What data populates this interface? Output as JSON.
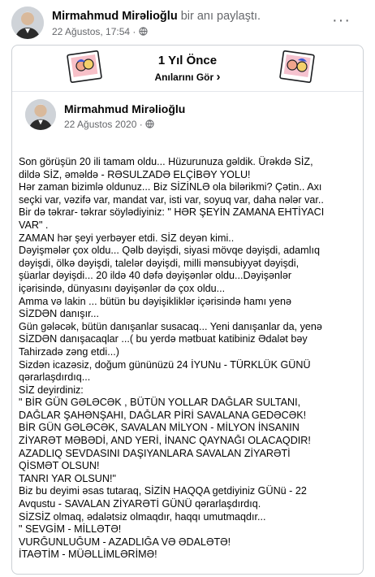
{
  "header": {
    "author": "Mirmahmud Mirəlioğlu",
    "action": "bir anı paylaştı.",
    "timestamp": "22 Ağustos, 17:54",
    "more_label": "···"
  },
  "memory": {
    "title": "1 Yıl Önce",
    "subtitle": "Anılarını Gör",
    "chevron": "›"
  },
  "original_post": {
    "author": "Mirmahmud Mirəlioğlu",
    "date": "22 Ağustos 2020",
    "lines": [
      "Son görüşün 20 ili tamam oldu... Hüzurunuza gəldik. Ürəkdə SİZ,",
      "dildə SİZ, əməldə - RƏSULZADƏ ELÇİBƏY YOLU!",
      "Hər zaman bizimlə oldunuz... Biz SİZİNLƏ ola bilərikmi? Çətin.. Axı",
      "seçki var, vəzifə var, mandat var, isti var, soyuq var, daha nələr var..",
      "Bir də təkrar- təkrar söylədiyiniz: \" HƏR ŞEYİN ZAMANA EHTİYACI",
      "VAR\" .",
      "ZAMAN hər şeyi yerbəyer etdi. SİZ deyən kimi..",
      "Dəyişmələr çox oldu... Qəlb dəyişdi, siyasi mövqe dəyişdi, adamlıq",
      "dəyişdi, ölkə dəyişdi, talelər dəyişdi, milli mənsubiyyət dəyişdi,",
      "şüarlar dəyişdi... 20 ildə 40 dəfə dəyişənlər oldu...Dəyişənlər",
      "içərisində, dünyasını dəyişənlər də çox oldu...",
      "Amma və lakin ... bütün  bu dəyişikliklər içərisində hamı yenə",
      "SİZDƏN danışır...",
      "Gün gələcək, bütün  danışanlar susacaq... Yeni danışanlar da, yenə",
      "SİZDƏN  danışacaqlar ...( bu yerdə mətbuat katibiniz Ədalət  bəy",
      "Tahirzadə zəng etdi...)",
      "Sizdən icazəsiz, doğum gününüzü 24 İYUNu - TÜRKLÜK  GÜNÜ",
      "qərarlaşdırdıq...",
      "SİZ deyirdiniz:",
      "\" BİR GÜN GƏLƏCƏK , BÜTÜN  YOLLAR DAĞLAR SULTANI,",
      "DAĞLAR ŞAHƏNŞAHI, DAĞLAR PİRİ SAVALANA GEDƏCƏK!",
      "BİR GÜN GƏLƏCƏK, SAVALAN MİLYON -  MİLYON İNSANIN",
      "ZİYARƏT MƏBƏDİ, AND YERİ, İNANC QAYNAĞI OLACAQDIR!",
      "  AZADLIQ SEVDASINI DAŞIYANLARA SAVALAN  ZİYARƏTİ",
      "QİSMƏT OLSUN!",
      "TANRI YAR OLSUN!\"",
      "Biz bu deyimi əsas tutaraq, SİZİN  HAQQA getdiyiniz GÜNü -   22",
      "Avqustu - SAVALAN ZİYARƏTİ GÜNÜ qərarlaşdırdıq.",
      "SİZSİZ olmaq, ədalətsiz olmaqdır, haqqı umutmaqdır...",
      "\" SEVGİM - MİLLƏTƏ!",
      "VURĞUNLUĞUM - AZADLIĞA VƏ ƏDALƏTƏ!",
      "İTAƏTİM - MÜƏLLİMLƏRİMƏ!"
    ]
  }
}
